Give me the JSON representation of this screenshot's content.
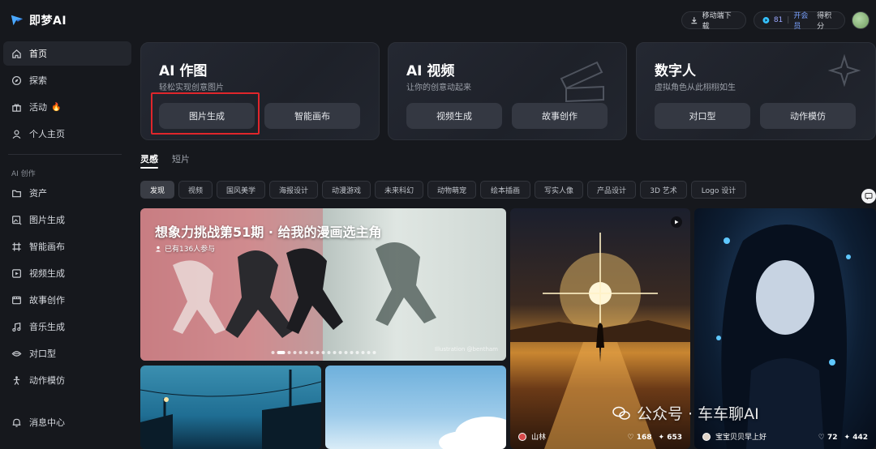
{
  "app": {
    "logo_text": "即梦AI"
  },
  "topbar": {
    "download_label": "移动端下载",
    "credits": "81",
    "vip_label": "开会员",
    "earn_label": "得积分"
  },
  "sidebar": {
    "items": [
      {
        "label": "首页",
        "icon": "home-icon"
      },
      {
        "label": "探索",
        "icon": "compass-icon"
      },
      {
        "label": "活动",
        "icon": "gift-icon",
        "badge": "🔥"
      },
      {
        "label": "个人主页",
        "icon": "user-icon"
      }
    ],
    "section_title": "AI 创作",
    "tools": [
      {
        "label": "资产",
        "icon": "folder-icon"
      },
      {
        "label": "图片生成",
        "icon": "image-gen-icon"
      },
      {
        "label": "智能画布",
        "icon": "canvas-icon"
      },
      {
        "label": "视频生成",
        "icon": "video-gen-icon"
      },
      {
        "label": "故事创作",
        "icon": "story-icon"
      },
      {
        "label": "音乐生成",
        "icon": "music-icon"
      },
      {
        "label": "对口型",
        "icon": "lipsync-icon"
      },
      {
        "label": "动作模仿",
        "icon": "motion-icon"
      }
    ],
    "notifications": "消息中心"
  },
  "cards": [
    {
      "title": "AI 作图",
      "subtitle": "轻松实现创意图片",
      "buttons": [
        "图片生成",
        "智能画布"
      ]
    },
    {
      "title": "AI 视频",
      "subtitle": "让你的创意动起来",
      "buttons": [
        "视频生成",
        "故事创作"
      ]
    },
    {
      "title": "数字人",
      "subtitle": "虚拟角色从此栩栩如生",
      "buttons": [
        "对口型",
        "动作模仿"
      ]
    }
  ],
  "content_tabs": [
    "灵感",
    "短片"
  ],
  "filters": [
    "发现",
    "视频",
    "国风美学",
    "海报设计",
    "动漫游戏",
    "未来科幻",
    "动物萌宠",
    "绘本插画",
    "写实人像",
    "产品设计",
    "3D 艺术",
    "Logo 设计"
  ],
  "banner": {
    "title": "想象力挑战第51期 · 给我的漫画选主角",
    "participants": "已有136人参与",
    "credit": "Illustration @bentham"
  },
  "tiles": {
    "sunset": {
      "author": "山林",
      "likes": "168",
      "remixes": "653"
    },
    "portrait": {
      "author": "宝宝贝贝早上好",
      "likes": "72",
      "remixes": "442"
    }
  },
  "watermark": "公众号 · 车车聊AI"
}
